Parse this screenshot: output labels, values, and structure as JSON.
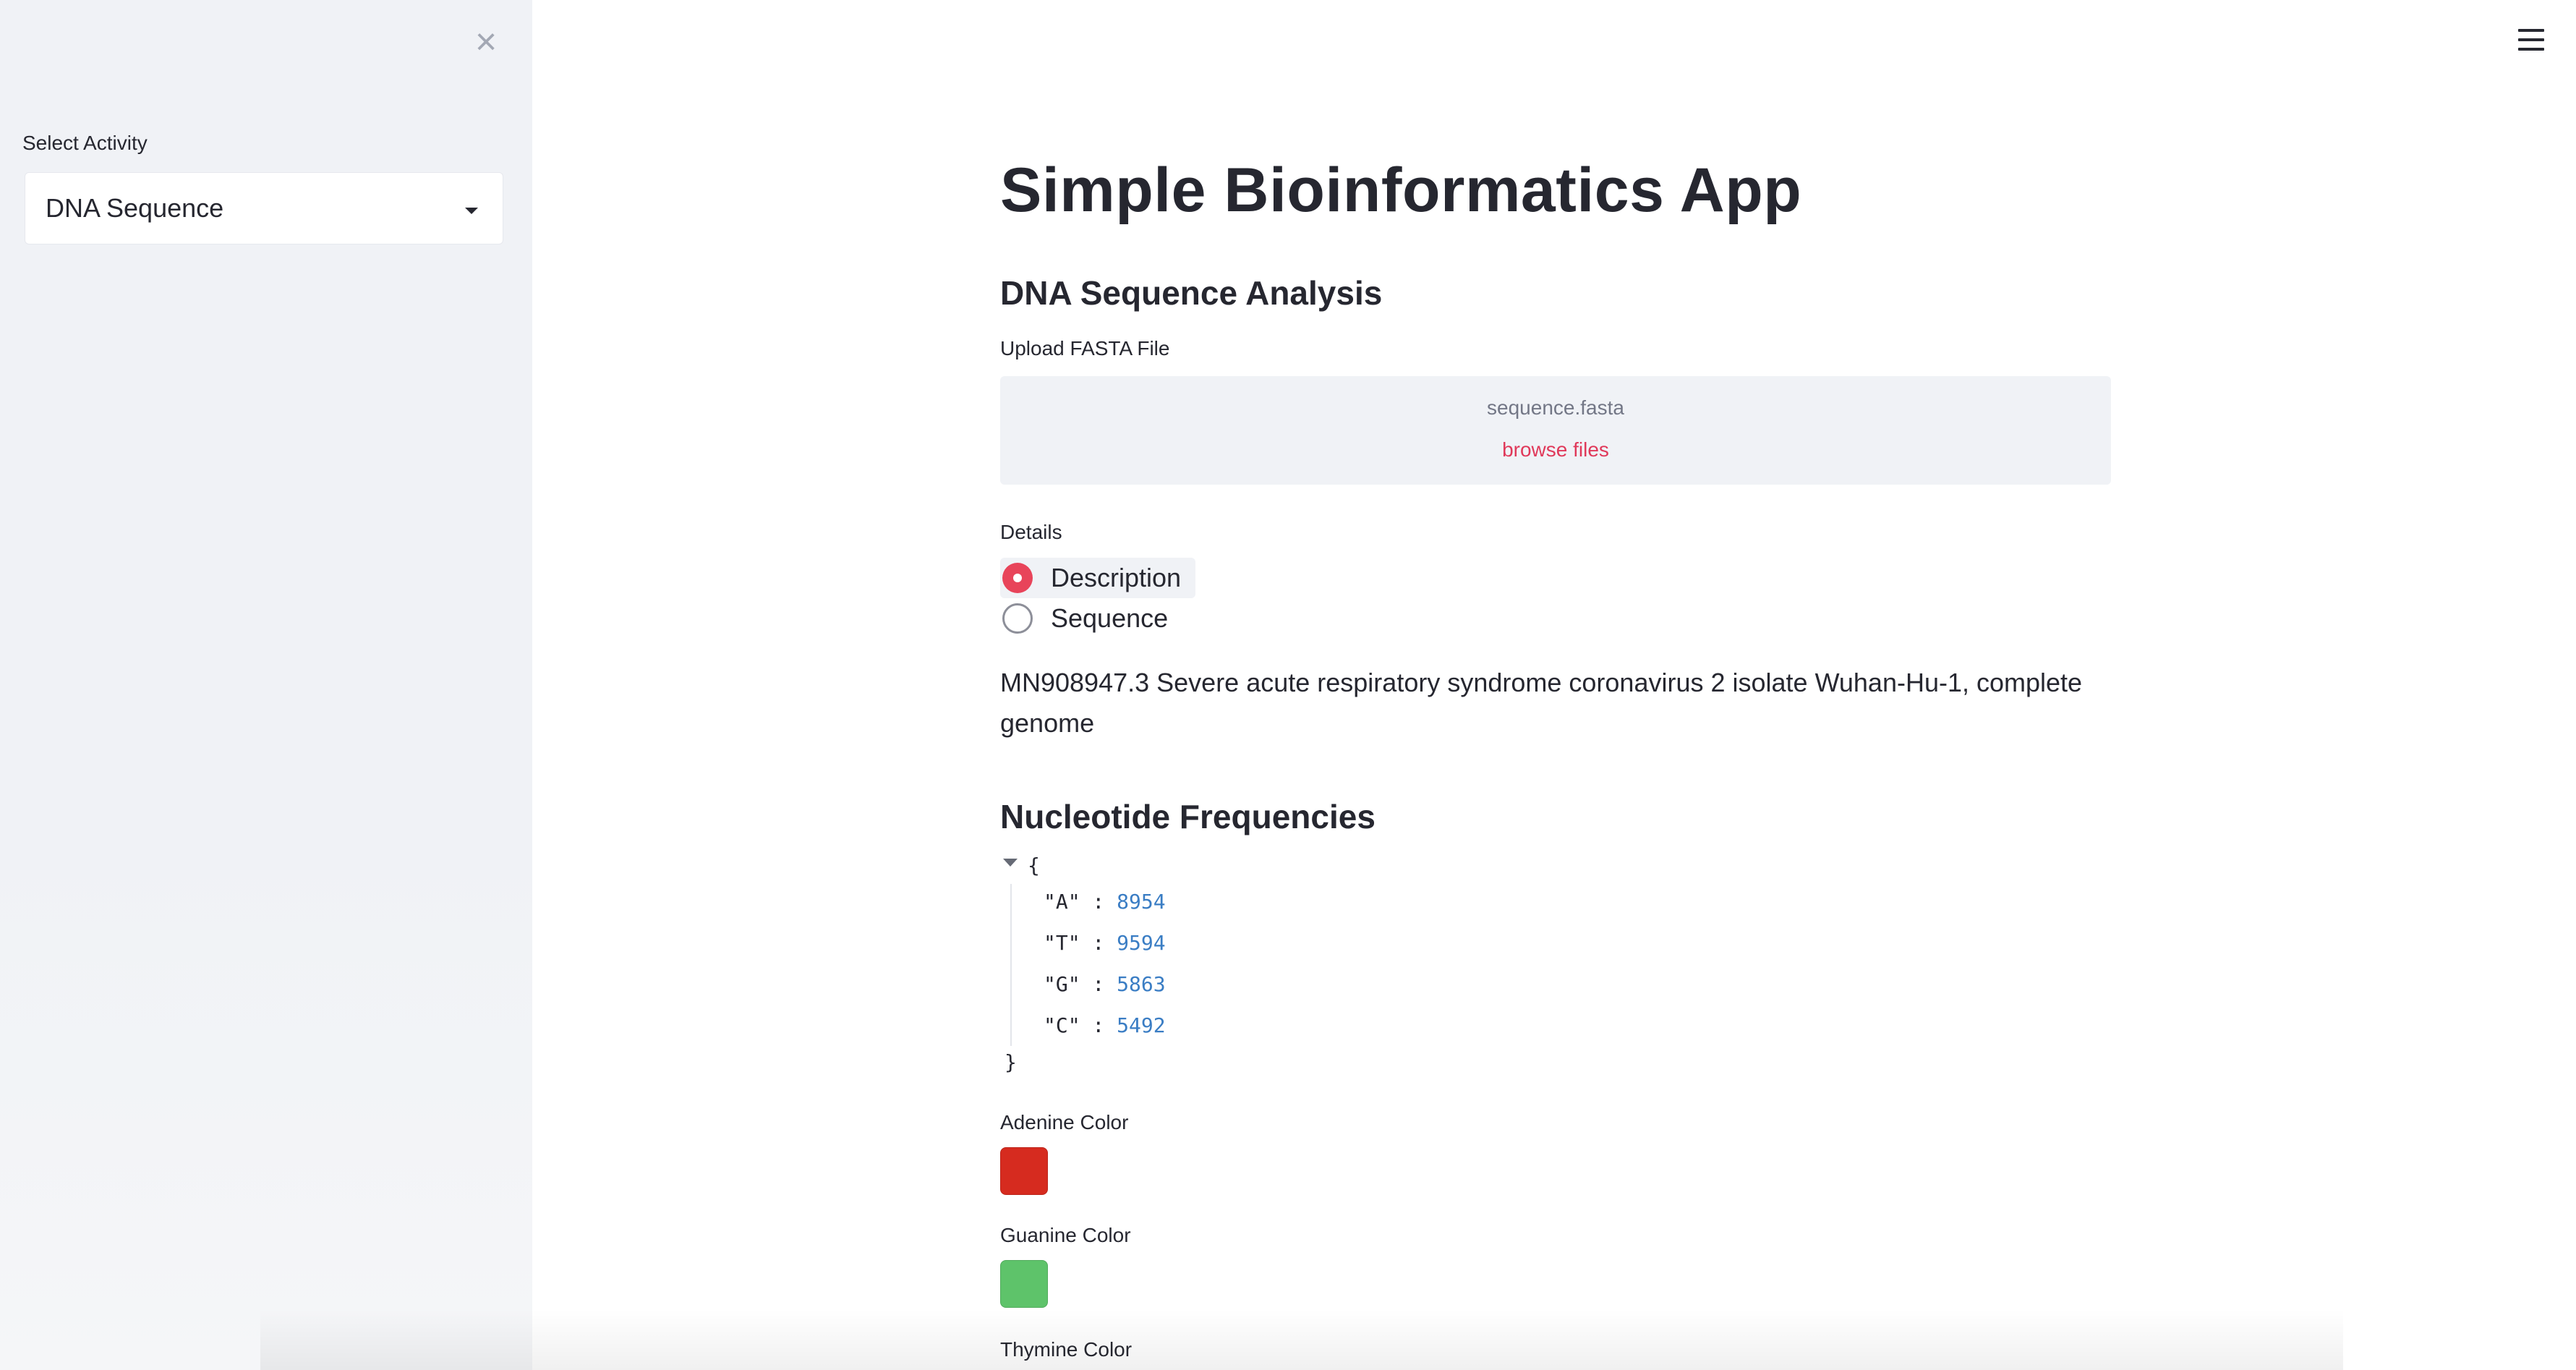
{
  "sidebar": {
    "close_icon": "close-icon",
    "select_label": "Select Activity",
    "select_value": "DNA Sequence"
  },
  "header": {
    "menu_icon": "hamburger-menu-icon"
  },
  "main": {
    "title": "Simple Bioinformatics App",
    "section_heading": "DNA Sequence Analysis",
    "uploader": {
      "label": "Upload FASTA File",
      "file_name": "sequence.fasta",
      "browse_label": "browse files"
    },
    "details": {
      "label": "Details",
      "options": [
        {
          "label": "Description",
          "selected": true
        },
        {
          "label": "Sequence",
          "selected": false
        }
      ]
    },
    "description_text": "MN908947.3 Severe acute respiratory syndrome coronavirus 2 isolate Wuhan-Hu-1, complete genome",
    "frequencies_heading": "Nucleotide Frequencies",
    "frequencies_json": {
      "open_brace": "{",
      "close_brace": "}",
      "entries": [
        {
          "key": "\"A\"",
          "sep": " : ",
          "value": "8954"
        },
        {
          "key": "\"T\"",
          "sep": " : ",
          "value": "9594"
        },
        {
          "key": "\"G\"",
          "sep": " : ",
          "value": "5863"
        },
        {
          "key": "\"C\"",
          "sep": " : ",
          "value": "5492"
        }
      ]
    },
    "color_pickers": [
      {
        "label": "Adenine Color",
        "color": "#d62b1f"
      },
      {
        "label": "Guanine Color",
        "color": "#5ec36a"
      },
      {
        "label": "Thymine Color",
        "color": ""
      }
    ]
  },
  "colors": {
    "accent": "#e8445a",
    "sidebar_bg": "#f0f2f6",
    "json_value": "#3a7dc4",
    "text": "#262730"
  }
}
